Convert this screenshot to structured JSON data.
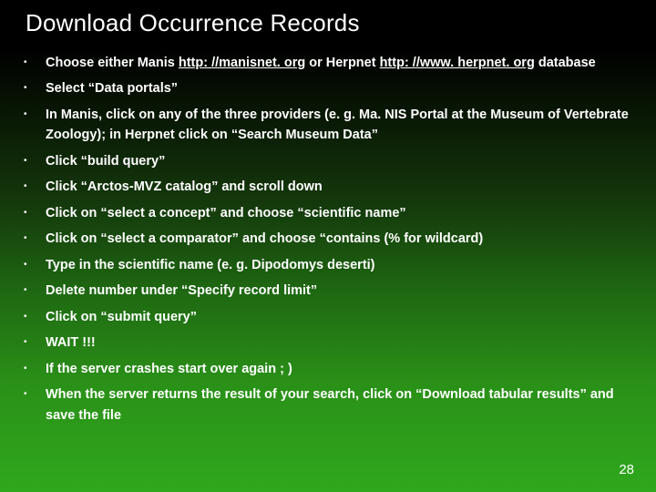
{
  "title": "Download Occurrence Records",
  "links": {
    "manis": "http: //manisnet. org",
    "herpnet": "http: //www. herpnet. org"
  },
  "bullets": {
    "b0_a": "Choose either Manis ",
    "b0_b": " or Herpnet ",
    "b0_c": " database",
    "b1": "Select “Data portals”",
    "b2": "In Manis, click on any of the three providers (e. g. Ma. NIS Portal at the Museum of Vertebrate Zoology); in Herpnet click on “Search Museum Data”",
    "b3": "Click “build query”",
    "b4": "Click “Arctos-MVZ catalog” and scroll down",
    "b5": "Click on “select a concept” and choose “scientific name”",
    "b6": "Click on “select a comparator” and choose “contains (% for wildcard)",
    "b7": "Type in the scientific name (e. g. Dipodomys deserti)",
    "b8": "Delete number under “Specify record limit”",
    "b9": "Click on “submit query”",
    "b10": "WAIT !!!",
    "b11": "If the server crashes start over again ; )",
    "b12": "When the server returns the result of your search, click on “Download tabular results” and save  the file"
  },
  "page_number": "28"
}
